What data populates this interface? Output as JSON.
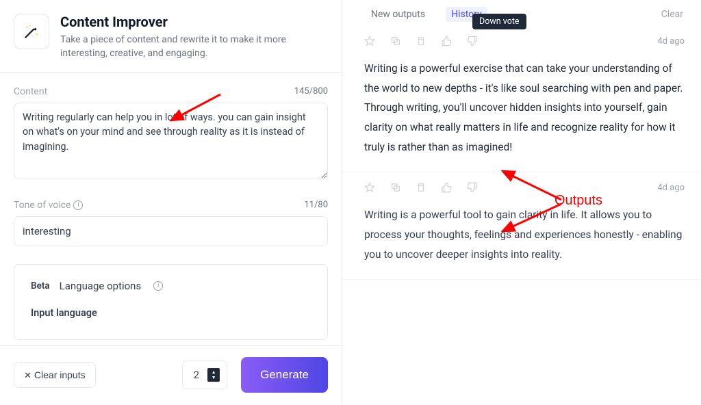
{
  "header": {
    "title": "Content Improver",
    "description": "Take a piece of content and rewrite it to make it more interesting, creative, and engaging."
  },
  "form": {
    "content_label": "Content",
    "content_counter": "145/800",
    "content_value": "Writing regularly can help you in lot of ways. you can gain insight on what's on your mind and see through reality as it is instead of imagining.",
    "tone_label": "Tone of voice",
    "tone_counter": "11/80",
    "tone_value": "interesting",
    "language": {
      "beta": "Beta",
      "title": "Language options",
      "sub": "Input language"
    }
  },
  "bottom": {
    "clear": "Clear inputs",
    "quantity": "2",
    "generate": "Generate"
  },
  "tabs": {
    "new": "New outputs",
    "history": "History",
    "clear": "Clear",
    "tooltip": "Down vote"
  },
  "outputs": [
    {
      "timestamp": "4d ago",
      "text": "Writing is a powerful exercise that can take your understanding of the world to new depths - it's like soul searching with pen and paper. Through writing, you'll uncover hidden insights into yourself, gain clarity on what really matters in life and recognize reality for how it truly is rather than as imagined!"
    },
    {
      "timestamp": "4d ago",
      "text": "Writing is a powerful tool to gain clarity in life. It allows you to process your thoughts, feelings and experiences honestly - enabling you to uncover deeper insights into reality."
    }
  ],
  "annotation": {
    "label": "Outputs"
  }
}
